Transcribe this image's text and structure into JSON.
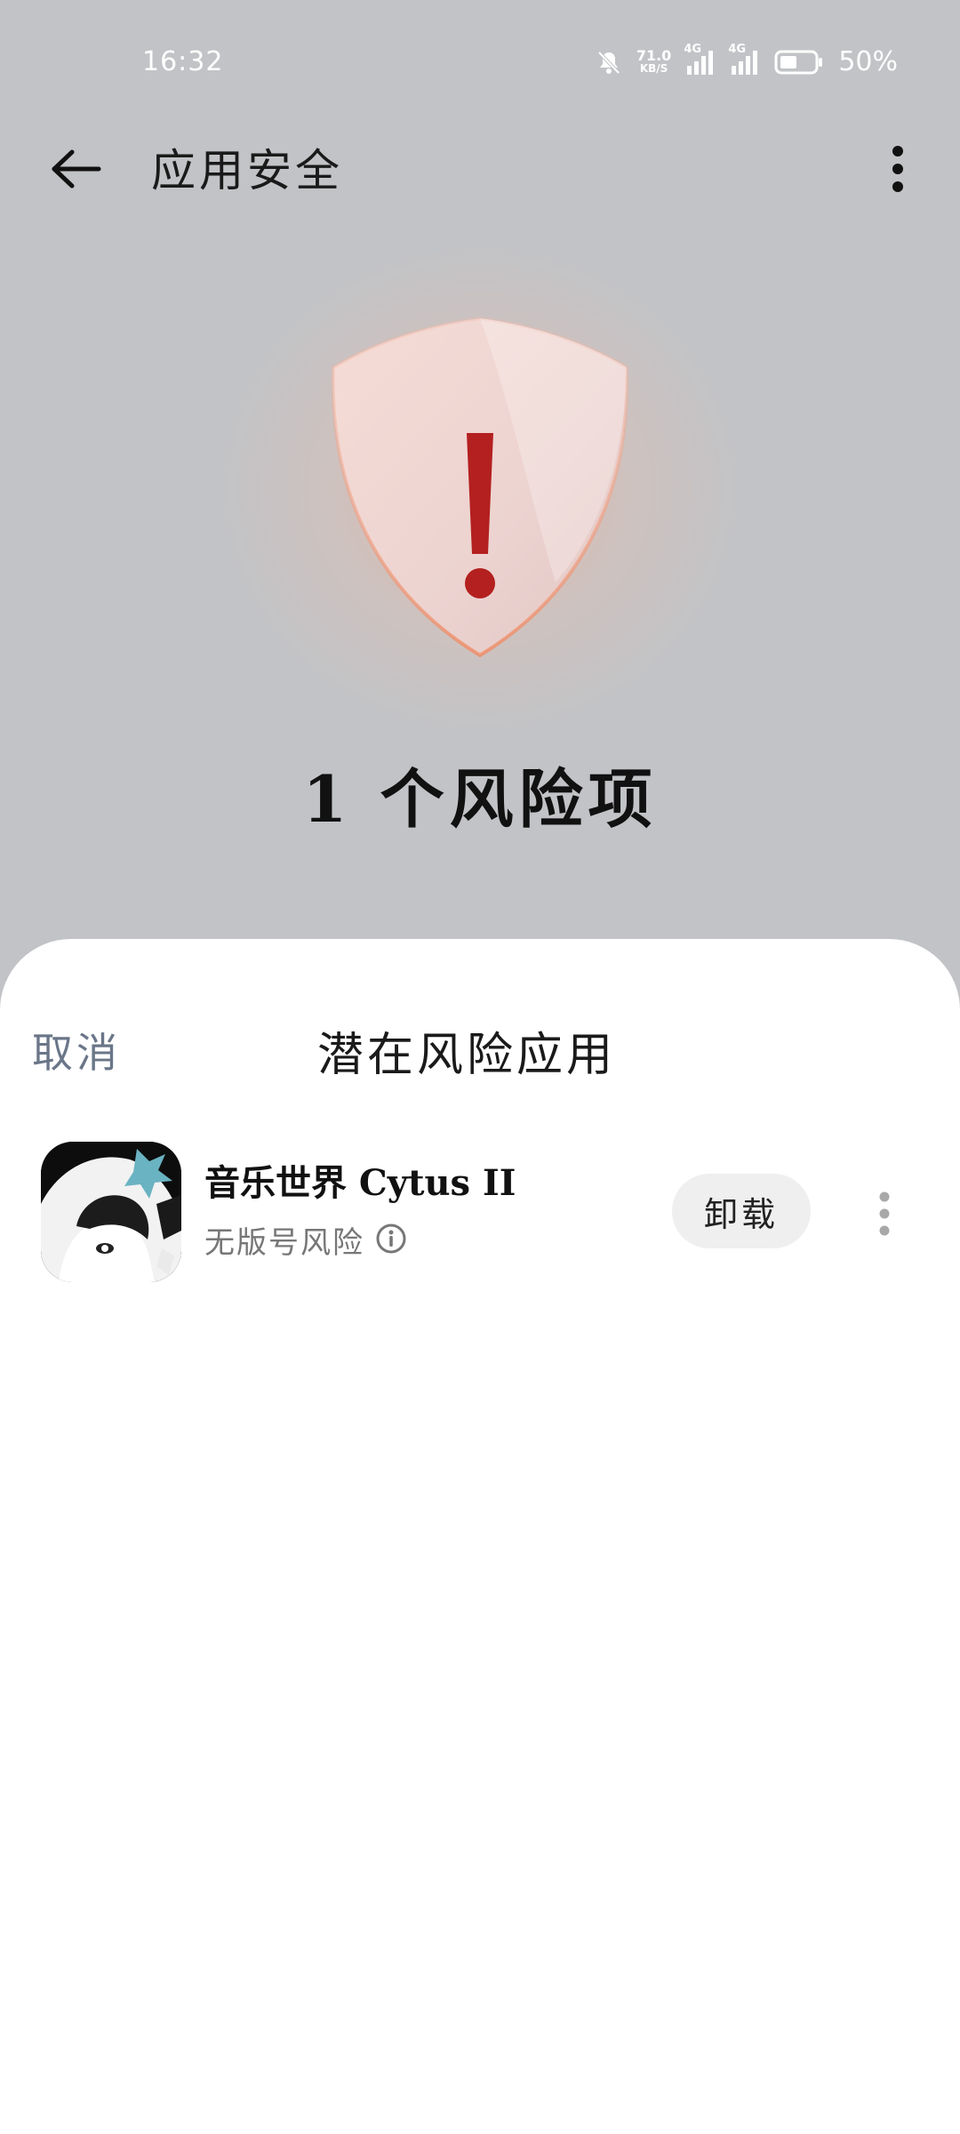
{
  "status_bar": {
    "time": "16:32",
    "net_speed_value": "71.0",
    "net_speed_unit": "KB/S",
    "sim1_tag": "4G",
    "sim2_tag": "4G",
    "battery_percent": "50%",
    "icons": [
      "bell-muted-icon",
      "signal-icon",
      "signal-icon",
      "battery-icon"
    ]
  },
  "app_bar": {
    "title": "应用安全",
    "back_icon": "arrow-left-icon",
    "more_icon": "more-vertical-icon"
  },
  "hero": {
    "shield_icon": "shield-warning-icon",
    "risk_count_text": "1 个风险项",
    "accent_color": "#b3201f"
  },
  "sheet": {
    "cancel_label": "取消",
    "title": "潜在风险应用",
    "apps": [
      {
        "name": "音乐世界 Cytus II",
        "risk_label": "无版号风险",
        "info_icon": "info-circle-icon",
        "uninstall_label": "卸载",
        "more_icon": "more-vertical-icon"
      }
    ]
  }
}
